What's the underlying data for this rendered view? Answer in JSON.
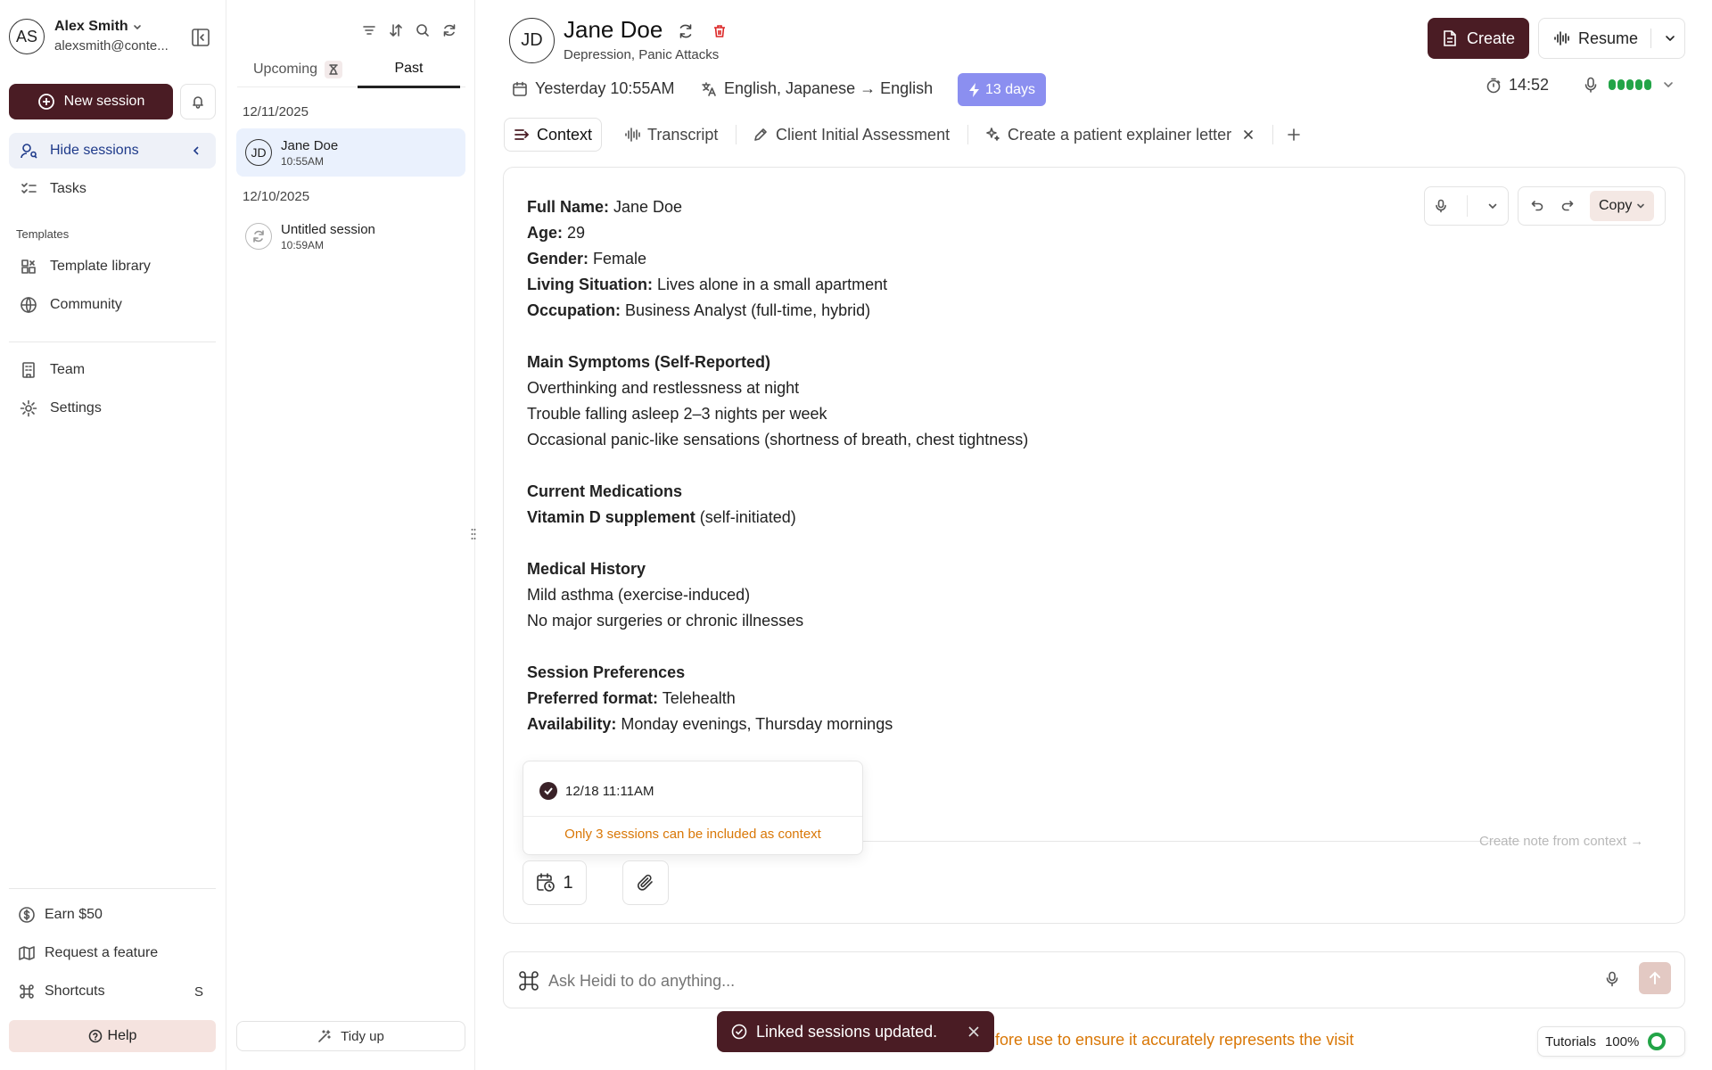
{
  "user": {
    "initials": "AS",
    "name": "Alex Smith",
    "email": "alexsmith@conte..."
  },
  "sidebar": {
    "new_session": "New session",
    "hide_sessions": "Hide sessions",
    "tasks": "Tasks",
    "templates_heading": "Templates",
    "template_library": "Template library",
    "community": "Community",
    "team": "Team",
    "settings": "Settings",
    "earn": "Earn $50",
    "request_feature": "Request a feature",
    "shortcuts": "Shortcuts",
    "shortcuts_key": "S",
    "help": "Help"
  },
  "sessions": {
    "tab_upcoming": "Upcoming",
    "tab_past": "Past",
    "groups": [
      {
        "date": "12/11/2025",
        "items": [
          {
            "initials": "JD",
            "name": "Jane Doe",
            "time": "10:55AM"
          }
        ]
      },
      {
        "date": "12/10/2025",
        "items": [
          {
            "name": "Untitled session",
            "time": "10:59AM"
          }
        ]
      }
    ],
    "tidy_up": "Tidy up"
  },
  "header": {
    "initials": "JD",
    "patient_name": "Jane Doe",
    "subtitle": "Depression, Panic Attacks",
    "date": "Yesterday 10:55AM",
    "languages": "English, Japanese → English",
    "days_badge": "13 days",
    "timer": "14:52",
    "create": "Create",
    "resume": "Resume"
  },
  "tabs": {
    "context": "Context",
    "transcript": "Transcript",
    "assessment": "Client Initial Assessment",
    "letter": "Create a patient explainer letter"
  },
  "toolbar": {
    "copy": "Copy"
  },
  "context": {
    "full_name_label": "Full Name:",
    "full_name": " Jane Doe",
    "age_label": "Age:",
    "age": " 29",
    "gender_label": "Gender:",
    "gender": " Female",
    "living_label": "Living Situation:",
    "living": " Lives alone in a small apartment",
    "occupation_label": "Occupation:",
    "occupation": " Business Analyst (full-time, hybrid)",
    "symptoms_heading": "Main Symptoms (Self-Reported)",
    "symptom_1": "Overthinking and restlessness at night",
    "symptom_2": "Trouble falling asleep 2–3 nights per week",
    "symptom_3": "Occasional panic-like sensations (shortness of breath, chest tightness)",
    "meds_heading": "Current Medications",
    "med_1_label": "Vitamin D supplement",
    "med_1": " (self-initiated)",
    "history_heading": "Medical History",
    "history_1": "Mild asthma (exercise-induced)",
    "history_2": "No major surgeries or chronic illnesses",
    "prefs_heading": "Session Preferences",
    "format_label": "Preferred format:",
    "format": " Telehealth",
    "availability_label": "Availability:",
    "availability": " Monday evenings, Thursday mornings"
  },
  "linked_popup": {
    "session": "12/18 11:11AM",
    "warning": "Only 3 sessions can be included as context"
  },
  "create_note": "Create note from context →",
  "linked_count": "1",
  "ask": {
    "placeholder": "Ask Heidi to do anything..."
  },
  "disclaimer": "fore use to ensure it accurately represents the visit",
  "toast": "Linked sessions updated.",
  "tutorials": {
    "label": "Tutorials",
    "percent": "100%"
  },
  "colors": {
    "brand": "#4a1c24",
    "accent_badge": "#8b8ff0",
    "warning": "#d97706",
    "active_bg": "#eef1f8",
    "status_green": "#22a447"
  }
}
